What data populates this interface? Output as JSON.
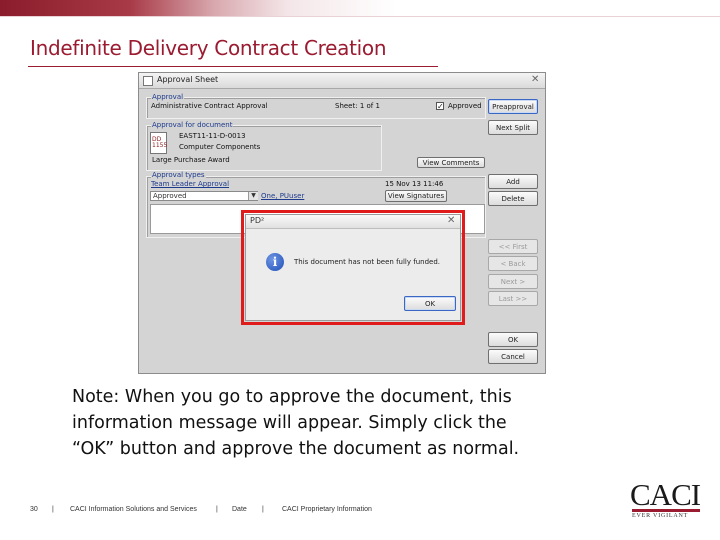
{
  "slide": {
    "title": "Indefinite Delivery Contract Creation",
    "note_lines": [
      "Note: When you go to approve the document,  this",
      "information message will appear.  Simply click the",
      "“OK” button and approve the document as normal."
    ]
  },
  "window": {
    "title": "Approval Sheet",
    "close": "✕",
    "approval_group": {
      "legend": "Approval",
      "name": "Administrative Contract Approval",
      "sheet": "Sheet: 1 of 1",
      "approved_label": "Approved",
      "approved_checked": "✓"
    },
    "document_group": {
      "legend": "Approval for document",
      "doc_number": "EAST11-11-D-0013",
      "doc_desc": "Computer Components",
      "doc_type": "Large Purchase Award",
      "icon_text": "DD 1155",
      "view_comments": "View Comments"
    },
    "types_group": {
      "legend": "Approval types",
      "type_link": "Team Leader Approval",
      "status": "Approved",
      "approver": "One, PUuser",
      "timestamp": "15 Nov 13   11:46",
      "view_signatures": "View Signatures"
    },
    "buttons": {
      "preapproval": "Preapproval",
      "next_split": "Next Split",
      "add": "Add",
      "delete": "Delete",
      "first": "<< First",
      "back": "< Back",
      "next": "Next >",
      "last": "Last >>",
      "ok": "OK",
      "cancel": "Cancel"
    }
  },
  "dialog": {
    "title": "PD²",
    "close": "✕",
    "icon": "i",
    "message": "This document has not been fully funded.",
    "ok": "OK"
  },
  "footer": {
    "page": "30",
    "sep1": "|",
    "company": "CACI Information Solutions and Services",
    "sep2": "|",
    "date": "Date",
    "sep3": "|",
    "proprietary": "CACI Proprietary Information"
  },
  "logo": {
    "word": "CACI",
    "tagline": "EVER VIGILANT"
  },
  "colors": {
    "accent": "#9b1b30",
    "highlight": "#e01b1b",
    "link": "#1d3a8c"
  }
}
